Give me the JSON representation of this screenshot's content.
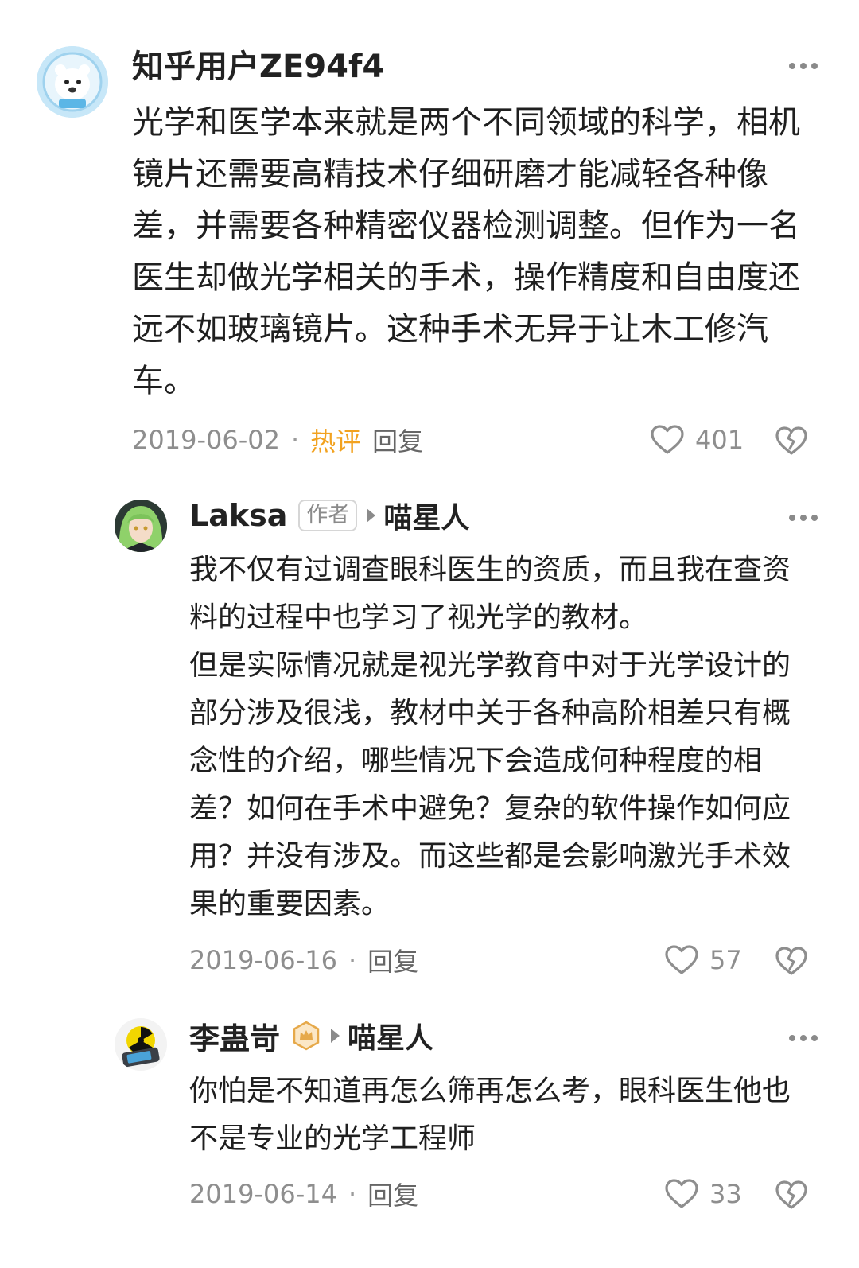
{
  "comments": [
    {
      "username": "知乎用户ZE94f4",
      "text": "光学和医学本来就是两个不同领域的科学，相机镜片还需要高精技术仔细研磨才能减轻各种像差，并需要各种精密仪器检测调整。但作为一名医生却做光学相关的手术，操作精度和自由度还远不如玻璃镜片。这种手术无异于让木工修汽车。",
      "date": "2019-06-02",
      "separator": "·",
      "hot_label": "热评",
      "reply_label": "回复",
      "likes": "401"
    },
    {
      "username": "Laksa",
      "author_badge": "作者",
      "reply_to": "喵星人",
      "text": "我不仅有过调查眼科医生的资质，而且我在查资料的过程中也学习了视光学的教材。\n但是实际情况就是视光学教育中对于光学设计的部分涉及很浅，教材中关于各种高阶相差只有概念性的介绍，哪些情况下会造成何种程度的相差？如何在手术中避免？复杂的软件操作如何应用？并没有涉及。而这些都是会影响激光手术效果的重要因素。",
      "date": "2019-06-16",
      "separator": "·",
      "reply_label": "回复",
      "likes": "57"
    },
    {
      "username": "李蛊岢",
      "reply_to": "喵星人",
      "text": "你怕是不知道再怎么筛再怎么考，眼科医生他也不是专业的光学工程师",
      "date": "2019-06-14",
      "separator": "·",
      "reply_label": "回复",
      "likes": "33"
    }
  ],
  "icons": {
    "more": "more-dots-icon",
    "like": "heart-icon",
    "dislike": "broken-heart-icon",
    "reply_arrow": "triangle-right-icon",
    "badge": "crown-badge-icon"
  },
  "colors": {
    "hot_label": "#f2a21f",
    "muted": "#8e8e8e",
    "text": "#1f1f1f"
  }
}
